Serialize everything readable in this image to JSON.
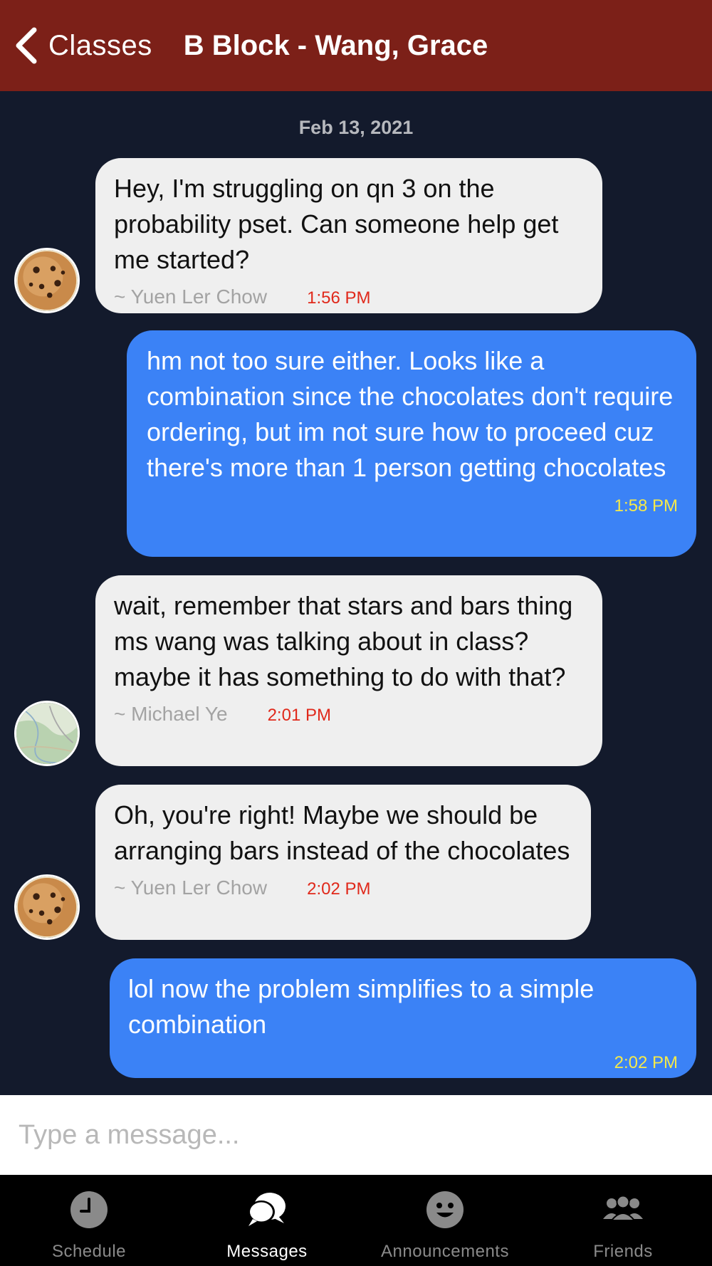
{
  "header": {
    "back_label": "Classes",
    "title": "B Block - Wang, Grace",
    "background": "#7c2018"
  },
  "chat": {
    "date": "Feb 13, 2021",
    "messages": [
      {
        "direction": "incoming",
        "text": "Hey, I'm struggling on qn 3 on the probability pset. Can someone help get me started?",
        "sender": "~ Yuen Ler Chow",
        "time": "1:56 PM",
        "avatar": "cookie-avatar"
      },
      {
        "direction": "outgoing",
        "text": "hm not too sure either. Looks like a combination since the chocolates don't require ordering, but im not sure how to proceed cuz there's more than 1 person getting chocolates",
        "time": "1:58 PM"
      },
      {
        "direction": "incoming",
        "text": "wait, remember that stars and bars thing ms wang was talking about in class? maybe it has something to do with that?",
        "sender": "~ Michael Ye",
        "time": "2:01 PM",
        "avatar": "map-avatar"
      },
      {
        "direction": "incoming",
        "text": "Oh, you're right! Maybe we should be arranging bars instead of the chocolates",
        "sender": "~ Yuen Ler Chow",
        "time": "2:02 PM",
        "avatar": "cookie-avatar"
      },
      {
        "direction": "outgoing",
        "text": "lol now the problem simplifies to a simple combination",
        "time": "2:02 PM"
      }
    ]
  },
  "composer": {
    "placeholder": "Type a message...",
    "value": ""
  },
  "tabs": [
    {
      "label": "Schedule",
      "icon": "clock-icon",
      "active": false
    },
    {
      "label": "Messages",
      "icon": "chat-bubbles-icon",
      "active": true
    },
    {
      "label": "Announcements",
      "icon": "smiley-icon",
      "active": false
    },
    {
      "label": "Friends",
      "icon": "people-icon",
      "active": false
    }
  ],
  "colors": {
    "chat_background": "#131a2c",
    "incoming_bubble": "#efefef",
    "outgoing_bubble": "#3b82f6",
    "incoming_time": "#e0291b",
    "outgoing_time": "#f5e94a"
  }
}
